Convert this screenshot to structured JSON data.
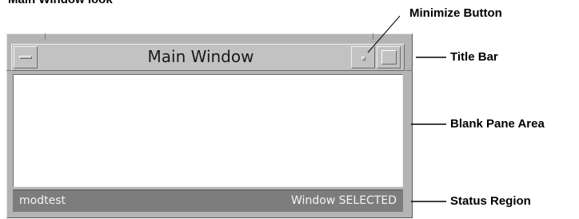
{
  "heading": "Main Window look",
  "window": {
    "title": "Main Window",
    "status_left": "modtest",
    "status_right": "Window SELECTED"
  },
  "callouts": {
    "minimize_button": "Minimize Button",
    "title_bar": "Title Bar",
    "blank_pane_area": "Blank Pane Area",
    "status_region": "Status Region"
  },
  "icons": {
    "window_menu": "window-menu-icon",
    "minimize": "minimize-icon",
    "maximize": "maximize-icon"
  }
}
